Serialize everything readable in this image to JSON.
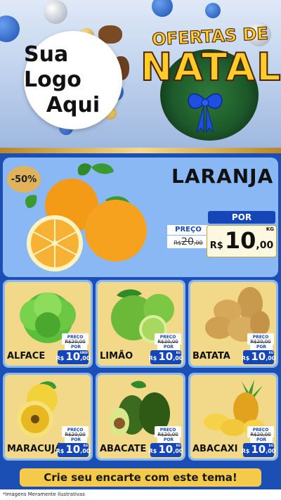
{
  "header": {
    "logo_line1": "Sua Logo",
    "logo_line2": "Aqui",
    "title_top": "OFERTAS DE",
    "title_main": "NATAL"
  },
  "featured": {
    "name": "LARANJA",
    "discount": "-50%",
    "por_label": "POR",
    "preco_label": "PREÇO",
    "old_currency": "R$",
    "old_int": "20",
    "old_dec": ",00",
    "currency": "R$",
    "price_int": "10",
    "price_dec": ",00",
    "unit": "KG"
  },
  "products": [
    {
      "name": "ALFACE",
      "unit": "UNID",
      "preco_label": "PREÇO",
      "old": "R$20,00",
      "por_label": "POR",
      "currency": "R$",
      "price_int": "10",
      "price_dec": ",00",
      "icon": "lettuce-icon"
    },
    {
      "name": "LIMÃO",
      "unit": "KG",
      "preco_label": "PREÇO",
      "old": "R$20,00",
      "por_label": "POR",
      "currency": "R$",
      "price_int": "10",
      "price_dec": ",00",
      "icon": "lime-icon"
    },
    {
      "name": "BATATA",
      "unit": "KG",
      "preco_label": "PREÇO",
      "old": "R$20,00",
      "por_label": "POR",
      "currency": "R$",
      "price_int": "10",
      "price_dec": ",00",
      "icon": "potato-icon"
    },
    {
      "name": "MARACUJÁ",
      "unit": "KG",
      "preco_label": "PREÇO",
      "old": "R$20,00",
      "por_label": "POR",
      "currency": "R$",
      "price_int": "10",
      "price_dec": ",00",
      "icon": "passion-fruit-icon"
    },
    {
      "name": "ABACATE",
      "unit": "KG",
      "preco_label": "PREÇO",
      "old": "R$20,00",
      "por_label": "POR",
      "currency": "R$",
      "price_int": "10",
      "price_dec": ",00",
      "icon": "avocado-icon"
    },
    {
      "name": "ABACAXI",
      "unit": "KG",
      "preco_label": "PREÇO",
      "old": "R$20,00",
      "por_label": "POR",
      "currency": "R$",
      "price_int": "10",
      "price_dec": ",00",
      "icon": "pineapple-icon"
    }
  ],
  "cta": "Crie seu encarte com este tema!",
  "footer_note": "*Imagens Meramente Ilustrativas",
  "colors": {
    "background": "#1c4fb3",
    "card": "#f2d98a",
    "accent_gold": "#f5ca4a",
    "price_blue": "#1546b8"
  }
}
